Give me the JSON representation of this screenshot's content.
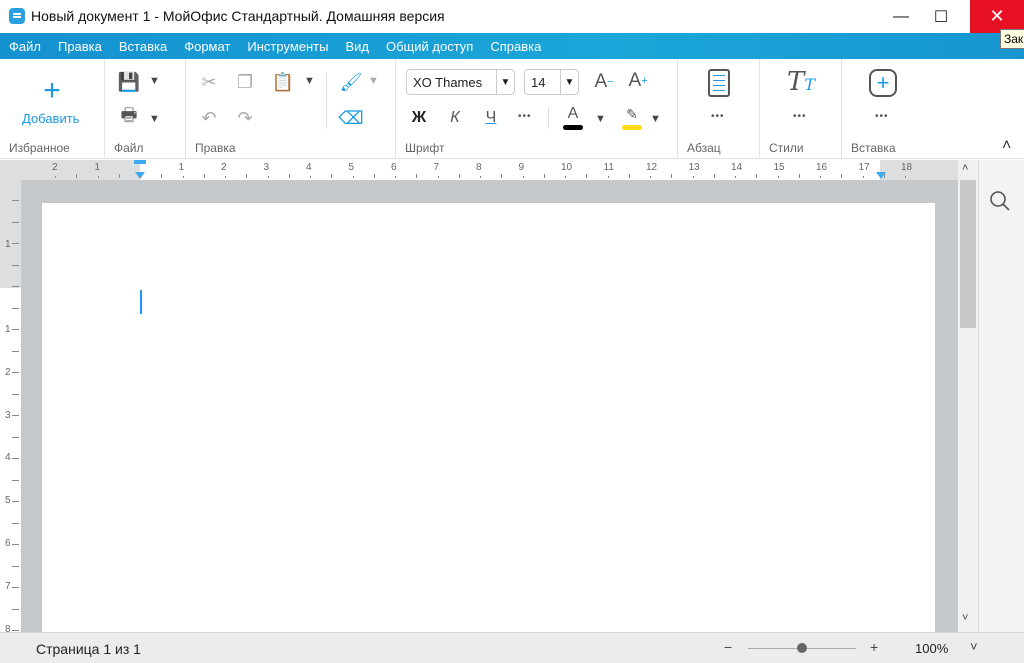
{
  "window": {
    "title": "Новый документ 1 - МойОфис Стандартный. Домашняя версия",
    "minimize": "—",
    "maximize": "☐",
    "close": "✕",
    "tooltip": "Зак"
  },
  "menu": [
    "Файл",
    "Правка",
    "Вставка",
    "Формат",
    "Инструменты",
    "Вид",
    "Общий доступ",
    "Справка"
  ],
  "ribbon": {
    "favorites": {
      "label": "Избранное",
      "add": "Добавить",
      "add_icon": "+"
    },
    "file": {
      "label": "Файл"
    },
    "edit": {
      "label": "Правка"
    },
    "font": {
      "label": "Шрифт",
      "family": "XO Thames",
      "size": "14",
      "bold": "Ж",
      "italic": "К",
      "underline": "Ч",
      "more": "•••",
      "decrease": "A",
      "increase": "A",
      "color_text": "A",
      "text_color": "#000000",
      "highlight_color": "#ffd91a"
    },
    "paragraph": {
      "label": "Абзац",
      "more": "•••"
    },
    "styles": {
      "label": "Стили",
      "icon_text": "T",
      "icon_sub": "T",
      "more": "•••"
    },
    "insert": {
      "label": "Вставка",
      "more": "•••"
    },
    "collapse": "˄"
  },
  "ruler": {
    "left_labels": [
      "2",
      "1"
    ],
    "labels": [
      "1",
      "2",
      "3",
      "4",
      "5",
      "6",
      "7",
      "8",
      "9",
      "10",
      "11",
      "12",
      "13",
      "14",
      "15",
      "16",
      "17",
      "18"
    ],
    "vertical_top": [
      "1"
    ],
    "vertical": [
      "1",
      "2",
      "3",
      "4",
      "5",
      "6",
      "7",
      "8"
    ]
  },
  "status": {
    "page": "Страница 1 из 1",
    "zoom_minus": "−",
    "zoom_plus": "+",
    "zoom": "100%",
    "zoom_level": 100,
    "chevron": "˅"
  },
  "accent": "#1ba0d9"
}
